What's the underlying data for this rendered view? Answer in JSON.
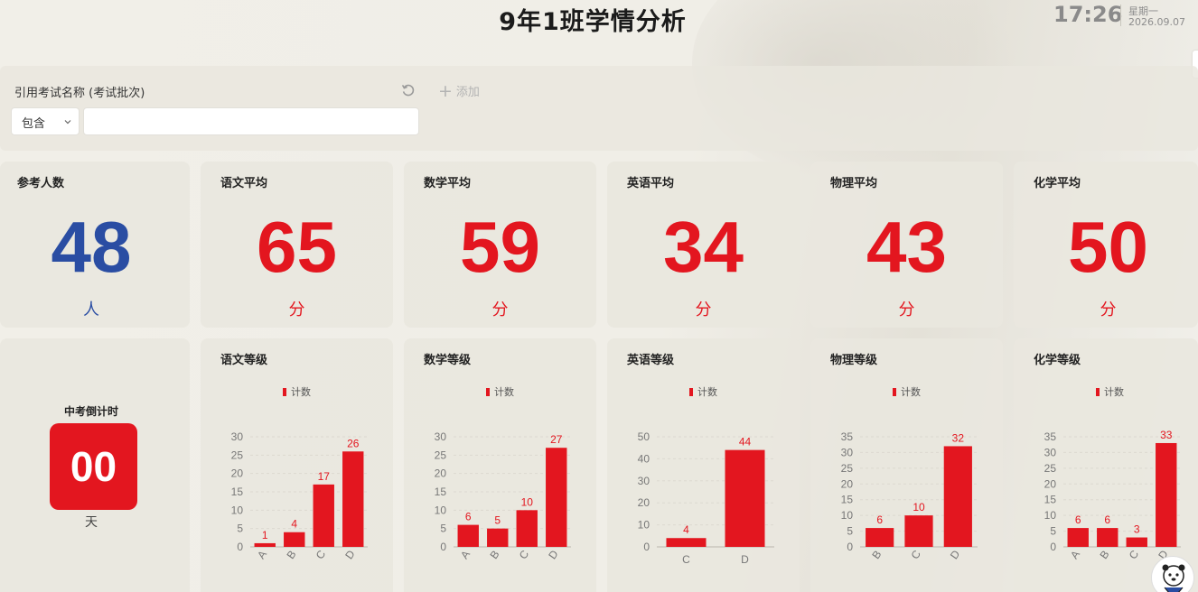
{
  "header": {
    "title": "9年1班学情分析",
    "time": "17:26",
    "weekday": "星期一",
    "date": "2026.09.07"
  },
  "filter": {
    "label": "引用考试名称 (考试批次)",
    "add_label": "添加",
    "operator": "包含",
    "value": "",
    "refresh_icon": "refresh-icon",
    "add_icon": "plus-icon"
  },
  "stats": [
    {
      "title": "参考人数",
      "value": "48",
      "unit": "人",
      "color": "#2a4da3"
    },
    {
      "title": "语文平均",
      "value": "65",
      "unit": "分",
      "color": "#e3161f"
    },
    {
      "title": "数学平均",
      "value": "59",
      "unit": "分",
      "color": "#e3161f"
    },
    {
      "title": "英语平均",
      "value": "34",
      "unit": "分",
      "color": "#e3161f"
    },
    {
      "title": "物理平均",
      "value": "43",
      "unit": "分",
      "color": "#e3161f"
    },
    {
      "title": "化学平均",
      "value": "50",
      "unit": "分",
      "color": "#e3161f"
    }
  ],
  "countdown": {
    "title": "中考倒计时",
    "value": "00",
    "unit": "天"
  },
  "legend_label": "计数",
  "chart_data": [
    {
      "type": "bar",
      "title": "语文等级",
      "categories": [
        "A",
        "B",
        "C",
        "D"
      ],
      "series": [
        {
          "name": "计数",
          "values": [
            1,
            4,
            17,
            26
          ]
        }
      ],
      "ylim": [
        0,
        30
      ],
      "yticks": [
        0,
        5,
        10,
        15,
        20,
        25,
        30
      ],
      "color": "#e3161f",
      "grid": true,
      "legend": "top"
    },
    {
      "type": "bar",
      "title": "数学等级",
      "categories": [
        "A",
        "B",
        "C",
        "D"
      ],
      "series": [
        {
          "name": "计数",
          "values": [
            6,
            5,
            10,
            27
          ]
        }
      ],
      "ylim": [
        0,
        30
      ],
      "yticks": [
        0,
        5,
        10,
        15,
        20,
        25,
        30
      ],
      "color": "#e3161f",
      "grid": true,
      "legend": "top"
    },
    {
      "type": "bar",
      "title": "英语等级",
      "categories": [
        "C",
        "D"
      ],
      "series": [
        {
          "name": "计数",
          "values": [
            4,
            44
          ]
        }
      ],
      "ylim": [
        0,
        50
      ],
      "yticks": [
        0,
        10,
        20,
        30,
        40,
        50
      ],
      "color": "#e3161f",
      "grid": true,
      "legend": "top"
    },
    {
      "type": "bar",
      "title": "物理等级",
      "categories": [
        "B",
        "C",
        "D"
      ],
      "series": [
        {
          "name": "计数",
          "values": [
            6,
            10,
            32
          ]
        }
      ],
      "ylim": [
        0,
        35
      ],
      "yticks": [
        0,
        5,
        10,
        15,
        20,
        25,
        30,
        35
      ],
      "color": "#e3161f",
      "grid": true,
      "legend": "top"
    },
    {
      "type": "bar",
      "title": "化学等级",
      "categories": [
        "A",
        "B",
        "C",
        "D"
      ],
      "series": [
        {
          "name": "计数",
          "values": [
            6,
            6,
            3,
            33
          ]
        }
      ],
      "ylim": [
        0,
        35
      ],
      "yticks": [
        0,
        5,
        10,
        15,
        20,
        25,
        30,
        35
      ],
      "color": "#e3161f",
      "grid": true,
      "legend": "top"
    }
  ]
}
